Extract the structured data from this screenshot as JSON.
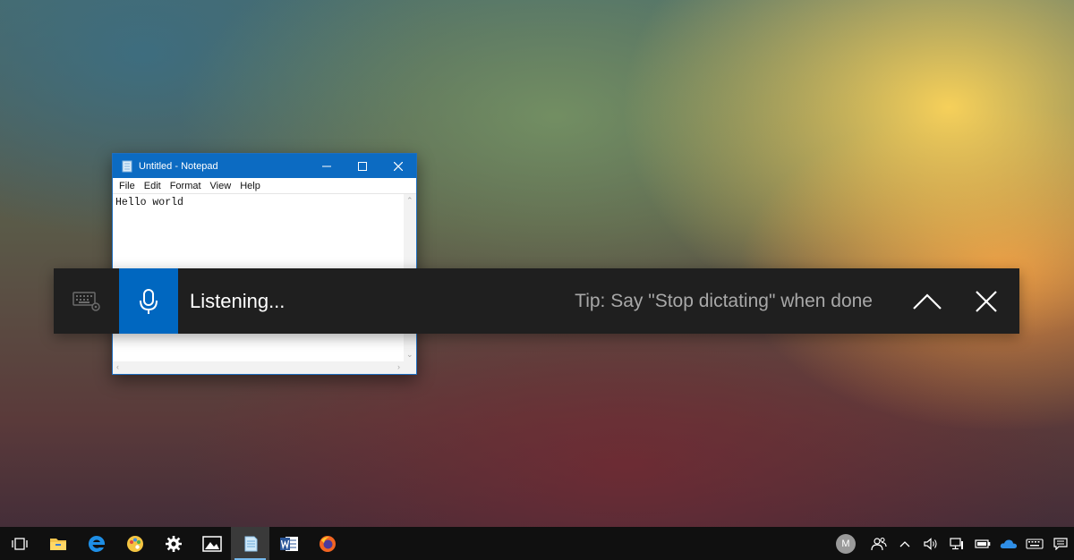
{
  "notepad": {
    "title": "Untitled - Notepad",
    "menus": [
      "File",
      "Edit",
      "Format",
      "View",
      "Help"
    ],
    "content": "Hello world"
  },
  "dictation": {
    "status": "Listening...",
    "tip": "Tip: Say \"Stop dictating\" when done",
    "icons": [
      "keyboard-settings-icon",
      "microphone-icon",
      "chevron-up-icon",
      "close-icon"
    ],
    "accent": "#0067c0",
    "bar_color": "#1f1f1f"
  },
  "taskbar": {
    "apps": [
      "task-view-icon",
      "file-explorer-icon",
      "edge-icon",
      "paint-3d-icon",
      "settings-icon",
      "photos-icon",
      "notepad-icon",
      "word-icon",
      "firefox-icon"
    ],
    "active_app": "notepad-icon",
    "tray": {
      "avatar_initial": "M",
      "icons": [
        "people-icon",
        "chevron-up-icon",
        "volume-icon",
        "network-icon",
        "battery-icon",
        "onedrive-icon",
        "keyboard-icon",
        "action-center-icon"
      ]
    }
  }
}
